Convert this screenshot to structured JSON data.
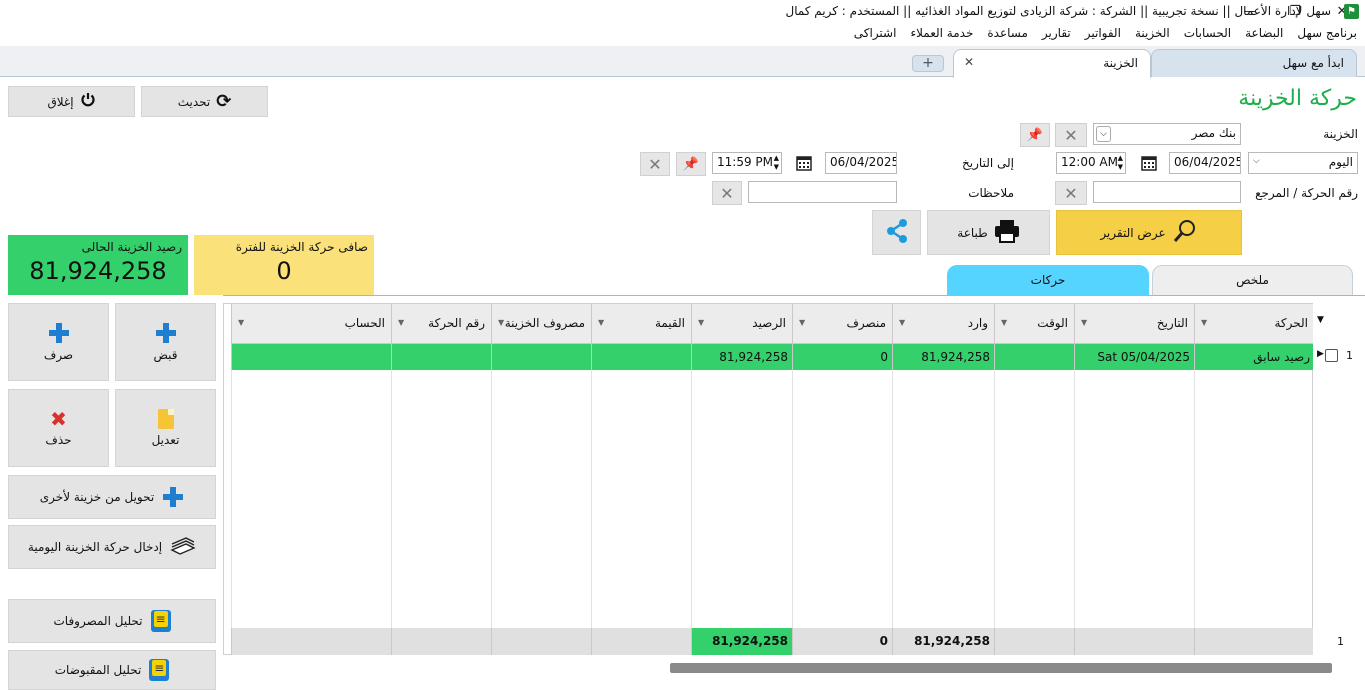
{
  "window": {
    "title": "سهل لإدارة الأعمال   ||   نسخة تجريبية   ||   الشركة : شركة الزيادى لتوزيع المواد الغذائيه   ||   المستخدم : كريم كمال",
    "minimize": "—",
    "maximize": "❐",
    "close": "✕"
  },
  "menu": [
    "برنامج سهل",
    "البضاعة",
    "الحسابات",
    "الخزينة",
    "الفواتير",
    "تقارير",
    "مساعدة",
    "خدمة العملاء",
    "اشتراكى"
  ],
  "tabs": {
    "start": "ابدأ مع سهل",
    "treasury": "الخزينة",
    "close": "✕",
    "add": "+"
  },
  "page": {
    "title": "حركة الخزينة",
    "close_btn": "إغلاق",
    "refresh_btn": "تحديث"
  },
  "filters": {
    "treasury_label": "الخزينة",
    "treasury_value": "بنك مصر",
    "period_value": "اليوم",
    "from_date": "06/04/2025",
    "from_time": "12:00 AM",
    "to_label": "إلى التاريخ",
    "to_date": "06/04/2025",
    "to_time": "11:59 PM",
    "ref_label": "رقم الحركة / المرجع",
    "ref_value": "",
    "notes_label": "ملاحظات",
    "notes_value": ""
  },
  "actions": {
    "show_report": "عرض التقرير",
    "print": "طباعة"
  },
  "kpis": {
    "balance_label": "رصيد الخزينة الحالى",
    "balance_value": "81,924,258",
    "net_label": "صافى حركة الخزينة للفترة",
    "net_value": "0"
  },
  "colors": {
    "green": "#33d06b",
    "yellow": "#fbe17a",
    "blue": "#55d4ff",
    "title_green": "#1fae4b",
    "report_btn": "#f5cf45"
  },
  "subtabs": {
    "summary": "ملخص",
    "movements": "حركات"
  },
  "grid": {
    "columns": [
      "الحركة",
      "التاريخ",
      "الوقت",
      "وارد",
      "منصرف",
      "الرصيد",
      "القيمة",
      "مصروف الخزينة",
      "رقم الحركة",
      "الحساب"
    ],
    "rows": [
      {
        "index": "1",
        "movement": "رصيد سابق",
        "date": "Sat 05/04/2025",
        "time": "",
        "incoming": "81,924,258",
        "outgoing": "0",
        "balance": "81,924,258",
        "value": "",
        "expense": "",
        "number": "",
        "account": ""
      }
    ],
    "footer": {
      "count": "1",
      "incoming": "81,924,258",
      "outgoing": "0",
      "balance": "81,924,258"
    }
  },
  "side": {
    "receive": "قبض",
    "pay": "صرف",
    "edit": "تعديل",
    "delete": "حذف",
    "transfer": "تحويل من خزينة لأخرى",
    "daily_entry": "إدخال حركة الخزينة اليومية",
    "expense_analysis": "تحليل المصروفات",
    "receipt_analysis": "تحليل المقبوضات"
  }
}
